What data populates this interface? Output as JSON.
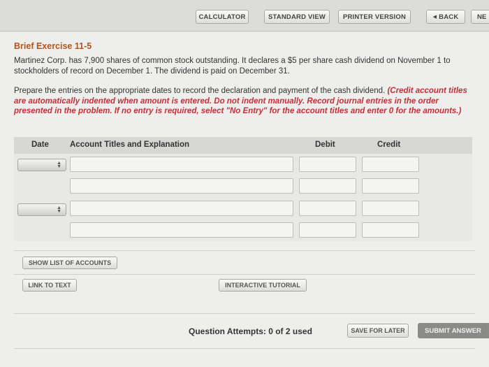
{
  "toolbar": {
    "calculator": "CALCULATOR",
    "standard_view": "STANDARD VIEW",
    "printer_version": "PRINTER VERSION",
    "back": "BACK",
    "next": "NE"
  },
  "exercise": {
    "title": "Brief Exercise 11-5",
    "problem": "Martinez Corp. has 7,900 shares of common stock outstanding. It declares a $5 per share cash dividend on November 1 to stockholders of record on December 1. The dividend is paid on December 31.",
    "prompt": "Prepare the entries on the appropriate dates to record the declaration and payment of the cash dividend.",
    "instructions": "(Credit account titles are automatically indented when amount is entered. Do not indent manually. Record journal entries in the order presented in the problem. If no entry is required, select \"No Entry\" for the account titles and enter 0 for the amounts.)"
  },
  "table": {
    "headers": {
      "date": "Date",
      "account": "Account Titles and Explanation",
      "debit": "Debit",
      "credit": "Credit"
    }
  },
  "buttons": {
    "show_list": "SHOW LIST OF ACCOUNTS",
    "link_text": "LINK TO TEXT",
    "tutorial": "INTERACTIVE TUTORIAL",
    "save_later": "SAVE FOR LATER",
    "submit": "SUBMIT ANSWER"
  },
  "footer": {
    "attempts": "Question Attempts: 0 of 2 used"
  },
  "colors": {
    "title": "#b3541e",
    "instructions": "#c4303a"
  }
}
